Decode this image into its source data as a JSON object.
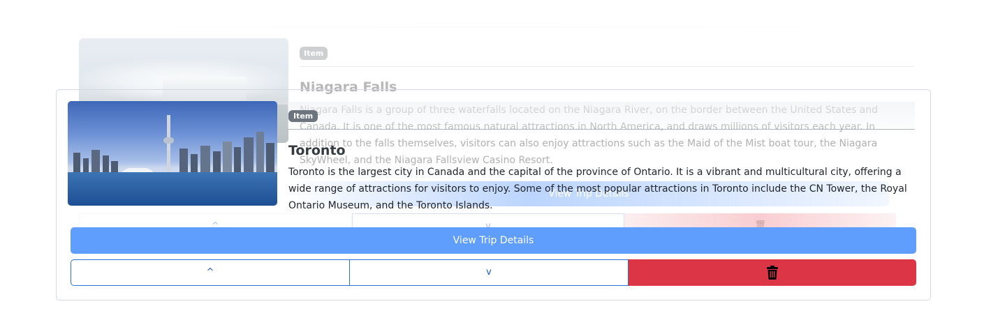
{
  "ghost_card": {
    "badge": "Item",
    "title": "Niagara Falls",
    "description": "Niagara Falls is a group of three waterfalls located on the Niagara River, on the border between the United States and Canada. It is one of the most famous natural attractions in North America, and draws millions of visitors each year. In addition to the falls themselves, visitors can also enjoy attractions such as the Maid of the Mist boat tour, the Niagara SkyWheel, and the Niagara Fallsview Casino Resort.",
    "view_label": "View Trip Details",
    "up_label": "^",
    "down_label": "v",
    "delete_icon": "trash-icon"
  },
  "card": {
    "badge": "Item",
    "title": "Toronto",
    "description": "Toronto is the largest city in Canada and the capital of the province of Ontario. It is a vibrant and multicultural city, offering a wide range of attractions for visitors to enjoy. Some of the most popular attractions in Toronto include the CN Tower, the Royal Ontario Museum, and the Toronto Islands.",
    "image_subject": "toronto-skyline",
    "view_label": "View Trip Details",
    "up_label": "^",
    "down_label": "v",
    "delete_icon": "trash-icon"
  },
  "colors": {
    "primary": "#609efd",
    "outline": "#2f6fd6",
    "danger": "#dc3545",
    "badge": "#6c757d"
  }
}
